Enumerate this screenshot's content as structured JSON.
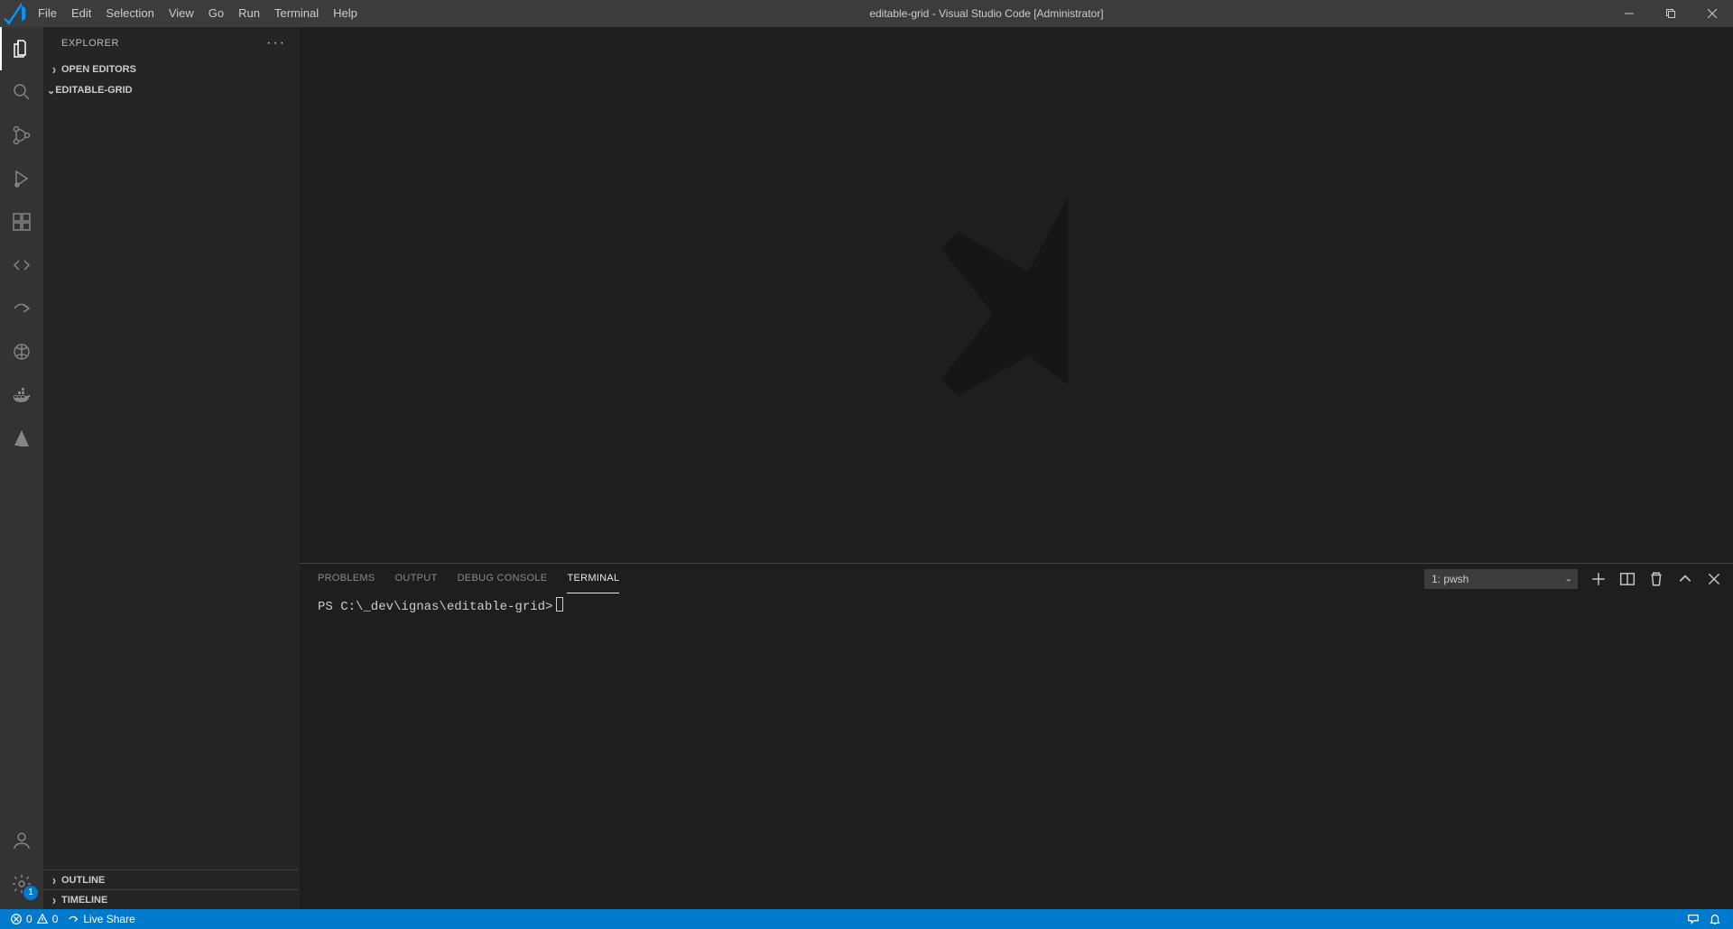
{
  "title": "editable-grid - Visual Studio Code [Administrator]",
  "menus": [
    "File",
    "Edit",
    "Selection",
    "View",
    "Go",
    "Run",
    "Terminal",
    "Help"
  ],
  "explorer": {
    "title": "EXPLORER",
    "openEditors": "OPEN EDITORS",
    "folderName": "EDITABLE-GRID",
    "outline": "OUTLINE",
    "timeline": "TIMELINE"
  },
  "panel": {
    "tabs": {
      "problems": "PROBLEMS",
      "output": "OUTPUT",
      "debug": "DEBUG CONSOLE",
      "terminal": "TERMINAL"
    },
    "terminalName": "1: pwsh",
    "prompt": "PS C:\\_dev\\ignas\\editable-grid>"
  },
  "status": {
    "errors": "0",
    "warnings": "0",
    "liveShare": "Live Share"
  },
  "settingsBadge": "1"
}
